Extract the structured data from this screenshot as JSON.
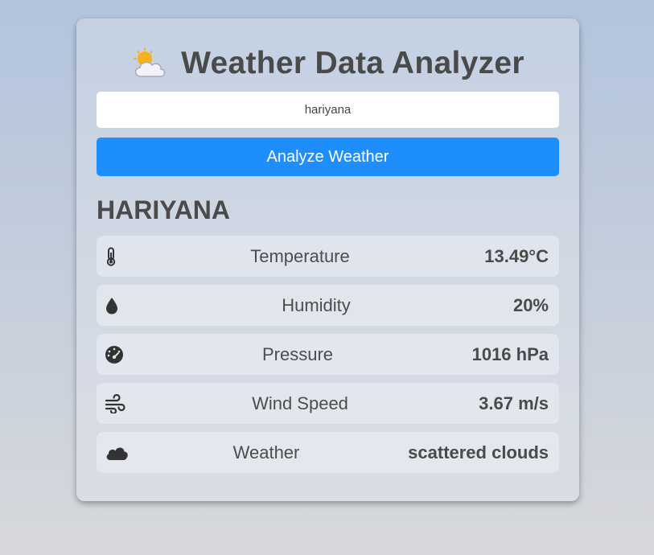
{
  "header": {
    "icon": "sun-behind-cloud-icon",
    "title": "Weather Data Analyzer"
  },
  "search": {
    "value": "hariyana"
  },
  "actions": {
    "analyze_label": "Analyze Weather"
  },
  "result": {
    "city": "HARIYANA",
    "metrics": [
      {
        "icon": "thermometer-icon",
        "label": "Temperature",
        "value": "13.49°C"
      },
      {
        "icon": "droplet-icon",
        "label": "Humidity",
        "value": "20%"
      },
      {
        "icon": "gauge-icon",
        "label": "Pressure",
        "value": "1016 hPa"
      },
      {
        "icon": "wind-icon",
        "label": "Wind Speed",
        "value": "3.67 m/s"
      },
      {
        "icon": "cloud-icon",
        "label": "Weather",
        "value": "scattered clouds"
      }
    ]
  },
  "colors": {
    "accent": "#1e8efc",
    "text": "#4a4a4a"
  }
}
